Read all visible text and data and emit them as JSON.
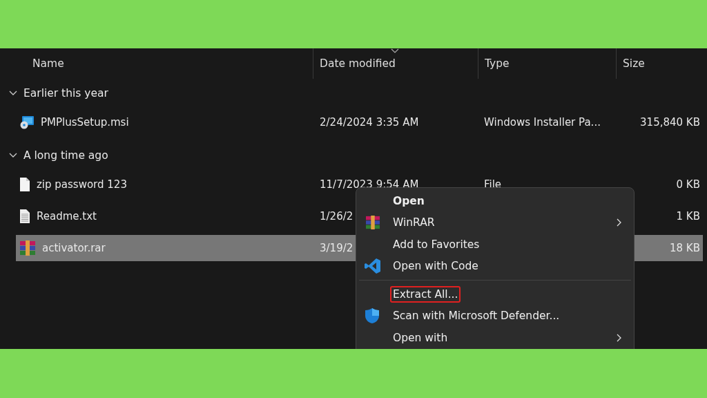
{
  "columns": [
    {
      "label": "Name",
      "sorted": false
    },
    {
      "label": "Date modified",
      "sorted": true
    },
    {
      "label": "Type",
      "sorted": false
    },
    {
      "label": "Size",
      "sorted": false
    }
  ],
  "groups": [
    {
      "label": "Earlier this year",
      "expanded": true,
      "files": [
        {
          "kind": "installer",
          "name": "PMPlusSetup.msi",
          "date": "2/24/2024 3:35 AM",
          "type": "Windows Installer Pa...",
          "size": "315,840 KB",
          "selected": false
        }
      ]
    },
    {
      "label": "A long time ago",
      "expanded": true,
      "files": [
        {
          "kind": "blank",
          "name": "zip password 123",
          "date": "11/7/2023 9:54 AM",
          "type": "File",
          "size": "0 KB",
          "selected": false
        },
        {
          "kind": "text",
          "name": "Readme.txt",
          "date": "1/26/2",
          "size": "1 KB",
          "selected": false
        },
        {
          "kind": "archive",
          "name": "activator.rar",
          "date": "3/19/2",
          "size": "18 KB",
          "selected": true
        }
      ]
    }
  ],
  "context_menu": {
    "items": [
      {
        "kind": "plain",
        "label": "Open",
        "bold": true,
        "submenu": false,
        "highlighted": false
      },
      {
        "kind": "archive",
        "label": "WinRAR",
        "bold": false,
        "submenu": true,
        "highlighted": false
      },
      {
        "kind": "plain",
        "label": "Add to Favorites",
        "bold": false,
        "submenu": false,
        "highlighted": false
      },
      {
        "kind": "code",
        "label": "Open with Code",
        "bold": false,
        "submenu": false,
        "highlighted": false
      },
      {
        "kind": "separator"
      },
      {
        "kind": "plain",
        "label": "Extract All...",
        "bold": false,
        "submenu": false,
        "highlighted": true
      },
      {
        "kind": "shield",
        "label": "Scan with Microsoft Defender...",
        "bold": false,
        "submenu": false,
        "highlighted": false
      },
      {
        "kind": "plain",
        "label": "Open with",
        "bold": false,
        "submenu": true,
        "highlighted": false
      }
    ]
  }
}
